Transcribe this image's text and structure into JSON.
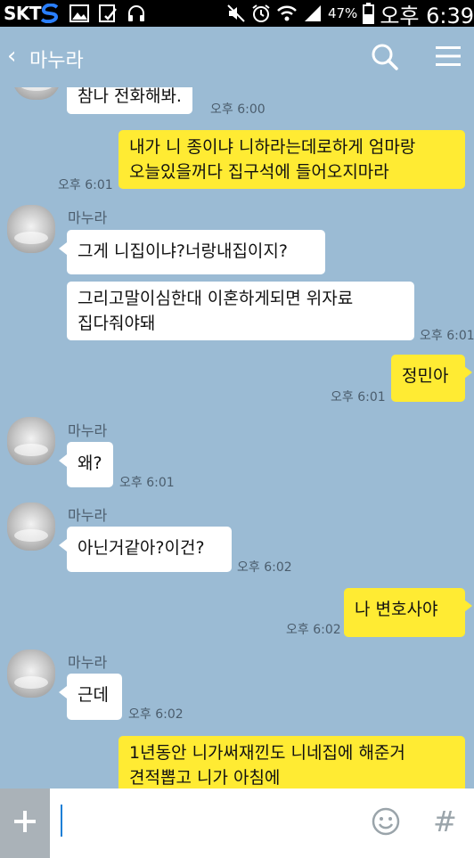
{
  "status": {
    "carrier": "SKT",
    "battery": "47%",
    "time": "오후 6:39"
  },
  "header": {
    "back": "‹",
    "title": "마누라"
  },
  "messages": {
    "m0": {
      "text": "참나 전화해봐.",
      "time": "오후 6:00"
    },
    "m1": {
      "line1": "내가 니 종이냐 니하라는데로하게 엄마랑",
      "line2": "오늘있을꺼다 집구석에 들어오지마라",
      "time": "오후 6:01"
    },
    "m2": {
      "sender": "마누라",
      "text": "그게 니집이냐?너랑내집이지?"
    },
    "m3": {
      "line1": "그리고말이심한대 이혼하게되면 위자료",
      "line2": "집다줘야돼",
      "time": "오후 6:01"
    },
    "m4": {
      "text": "정민아",
      "time": "오후 6:01"
    },
    "m5": {
      "sender": "마누라",
      "text": "왜?",
      "time": "오후 6:01"
    },
    "m6": {
      "sender": "마누라",
      "text": "아닌거같아?이건?",
      "time": "오후 6:02"
    },
    "m7": {
      "text": "나 변호사야",
      "time": "오후 6:02"
    },
    "m8": {
      "sender": "마누라",
      "text": "근데",
      "time": "오후 6:02"
    },
    "m9": {
      "line1": "1년동안 니가써재낀도 니네집에 해준거",
      "line2": "견적뽑고 니가 아침에"
    }
  },
  "input": {
    "hash": "#"
  },
  "icons": {
    "back": "chevron-left-icon",
    "search": "search-icon",
    "menu": "hamburger-menu-icon",
    "plus": "plus-icon",
    "emoji": "emoji-icon"
  },
  "colors": {
    "background": "#9bbbd4",
    "outgoing_bubble": "#ffeb33",
    "incoming_bubble": "#ffffff"
  }
}
